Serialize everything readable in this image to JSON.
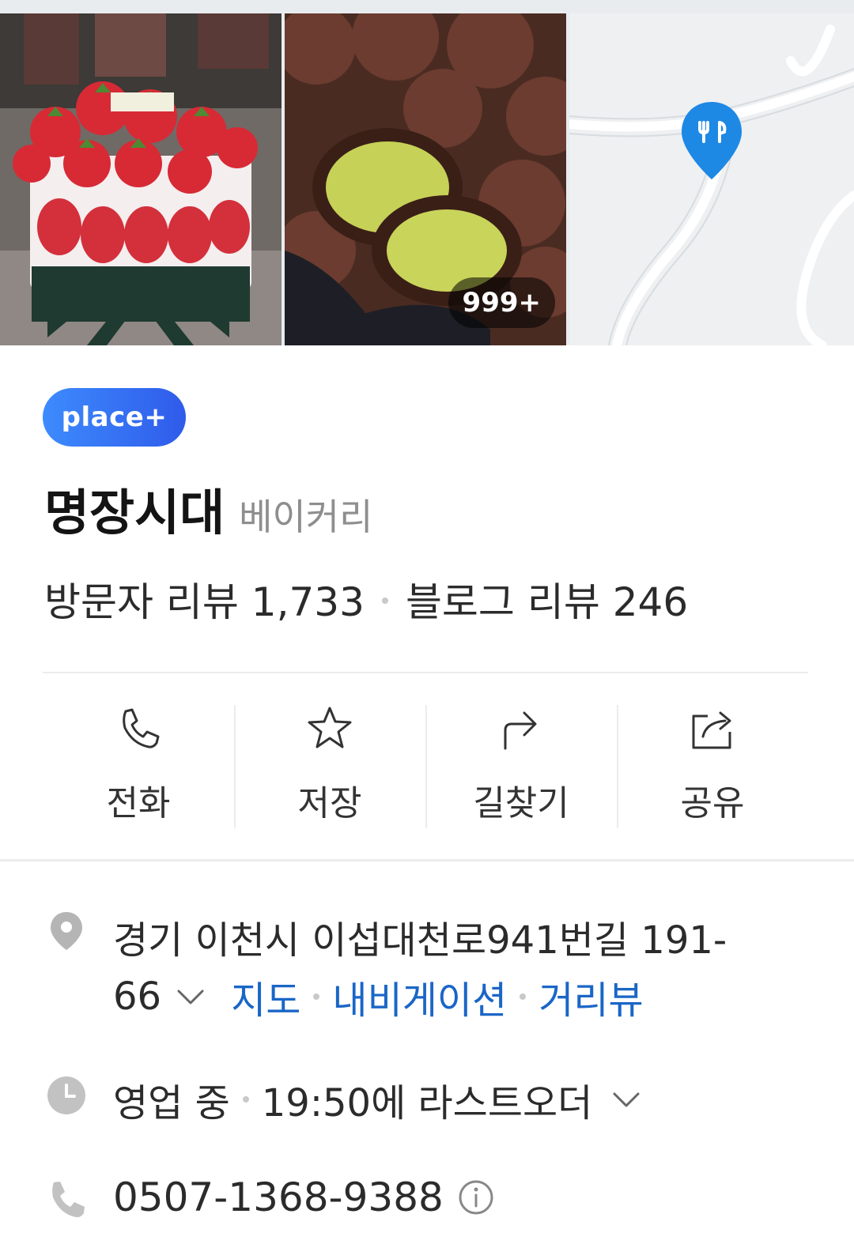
{
  "photos": {
    "count_badge": "999+",
    "items": [
      {
        "alt": "strawberry-cake-photo"
      },
      {
        "alt": "pistachio-chocolate-bread-photo"
      },
      {
        "alt": "map-thumbnail"
      }
    ]
  },
  "header": {
    "badge": "place+",
    "name": "명장시대",
    "category": "베이커리",
    "visitor_reviews": "방문자 리뷰 1,733",
    "blog_reviews": "블로그 리뷰 246"
  },
  "actions": [
    {
      "label": "전화",
      "icon": "phone-icon"
    },
    {
      "label": "저장",
      "icon": "star-icon"
    },
    {
      "label": "길찾기",
      "icon": "directions-icon"
    },
    {
      "label": "공유",
      "icon": "share-icon"
    }
  ],
  "details": {
    "address_line1": "경기 이천시 이섭대천로941번길 191-",
    "address_line2": "66",
    "links": {
      "map": "지도",
      "navigation": "내비게이션",
      "street_view": "거리뷰"
    },
    "status": "영업 중",
    "hours_note": "19:50에 라스트오더",
    "phone": "0507-1368-9388"
  },
  "colors": {
    "accent_link": "#1a66c7",
    "badge_gradient_start": "#3d8bfd",
    "badge_gradient_end": "#2f5bea",
    "map_pin": "#1e88e5"
  }
}
